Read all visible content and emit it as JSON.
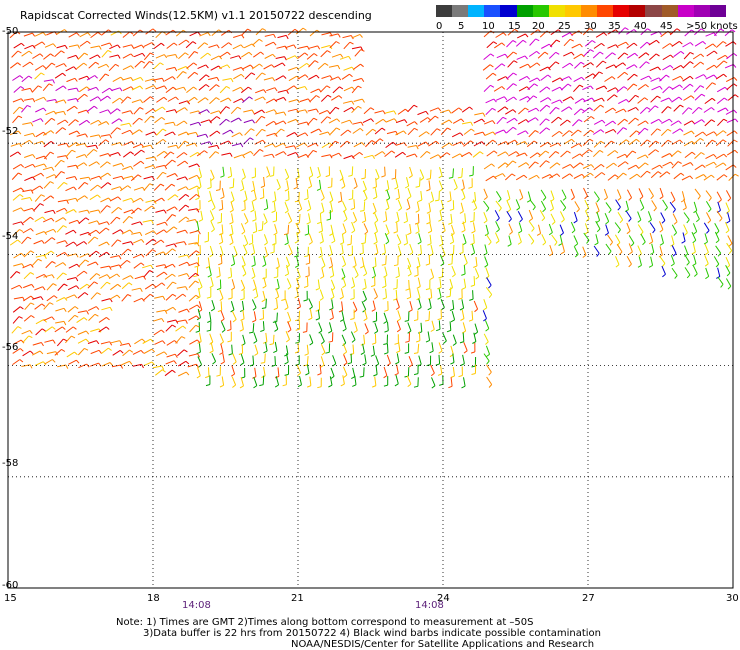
{
  "title": "Rapidscat Corrected Winds(12.5KM) v1.1 20150722 descending",
  "legend": {
    "ticks": [
      "0",
      "5",
      "10",
      "15",
      "20",
      "25",
      "30",
      "35",
      "40",
      "45",
      ">50 knots"
    ],
    "colors": [
      "#3c3c3c",
      "#7a7a7a",
      "#00b4ff",
      "#1a50ff",
      "#0000d0",
      "#00a000",
      "#28c800",
      "#f0e000",
      "#ffc800",
      "#ff8c00",
      "#ff4600",
      "#e60000",
      "#b40000",
      "#8c4646",
      "#a05a28",
      "#c800c8",
      "#a000b4",
      "#6e0096"
    ]
  },
  "axes": {
    "y_labels": [
      "-50",
      "-52",
      "-54",
      "-56",
      "-58",
      "-60"
    ],
    "x_labels": [
      "15",
      "18",
      "21",
      "24",
      "27",
      "30"
    ],
    "gmt_times": [
      "14:08",
      "14:08"
    ]
  },
  "notes": {
    "line1": "Note: 1) Times are GMT 2)Times along bottom correspond to measurement at –50S",
    "line2": "3)Data buffer is 22 hrs from 20150722 4) Black wind barbs indicate possible contamination",
    "line3": "NOAA/NESDIS/Center for Satellite Applications and Research"
  },
  "map_data": {
    "lon_range": [
      15,
      30
    ],
    "lat_range": [
      -60,
      -50
    ],
    "swath_regions": [
      {
        "name": "west-swath",
        "lon": [
          15,
          22
        ],
        "lat": [
          -56.6,
          -50
        ],
        "dominant_speed_knots": "25-35"
      },
      {
        "name": "central-swath",
        "lon": [
          19,
          25
        ],
        "lat": [
          -56.6,
          -51.5
        ],
        "dominant_speed_knots": "20-30"
      },
      {
        "name": "east-swath-north",
        "lon": [
          25,
          30
        ],
        "lat": [
          -53.2,
          -50
        ],
        "dominant_speed_knots": "35-50"
      },
      {
        "name": "east-swath-south",
        "lon": [
          25,
          30
        ],
        "lat": [
          -55,
          -53.2
        ],
        "dominant_speed_knots": "15-25"
      }
    ]
  }
}
